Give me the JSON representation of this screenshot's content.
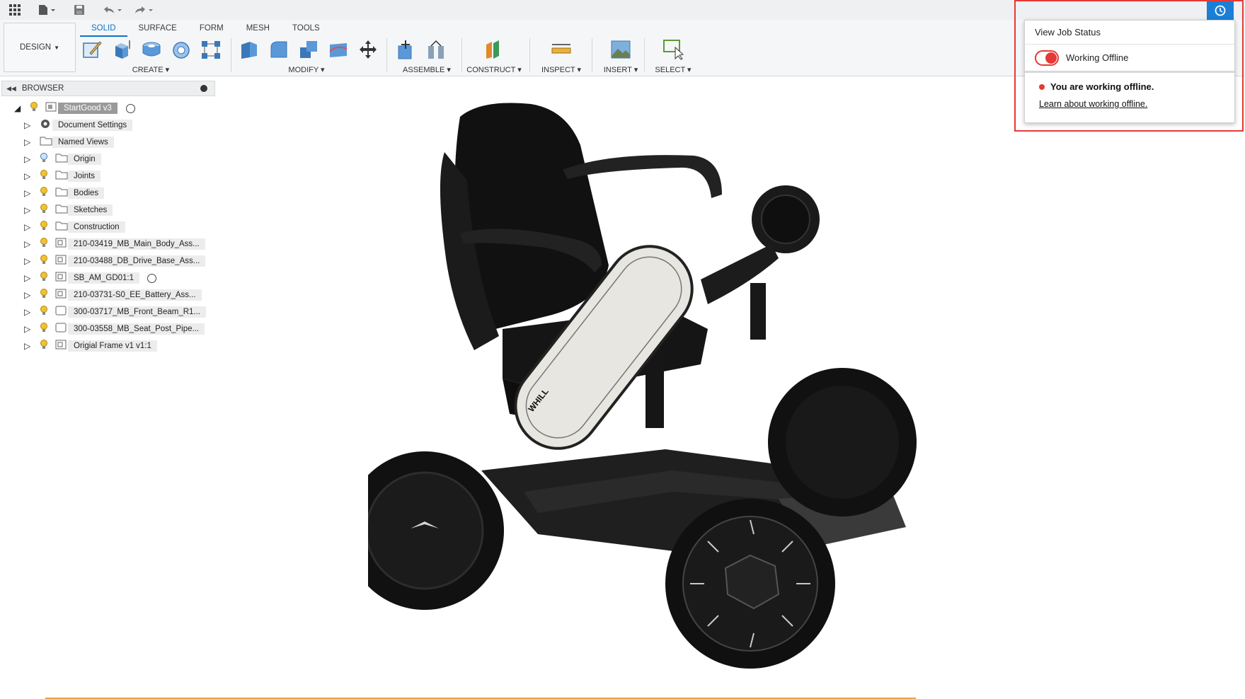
{
  "ribbon": {
    "design_label": "DESIGN",
    "tabs": [
      {
        "label": "SOLID",
        "active": true
      },
      {
        "label": "SURFACE",
        "active": false
      },
      {
        "label": "FORM",
        "active": false
      },
      {
        "label": "MESH",
        "active": false
      },
      {
        "label": "TOOLS",
        "active": false
      }
    ],
    "groups": {
      "create": "CREATE",
      "modify": "MODIFY",
      "assemble": "ASSEMBLE",
      "construct": "CONSTRUCT",
      "inspect": "INSPECT",
      "insert": "INSERT",
      "select": "SELECT"
    }
  },
  "browser": {
    "title": "BROWSER",
    "root": "StartGood v3",
    "items": [
      {
        "label": "Document Settings",
        "icon": "gear-icon"
      },
      {
        "label": "Named Views",
        "icon": "folder-icon"
      },
      {
        "label": "Origin",
        "icon": "folder-icon"
      },
      {
        "label": "Joints",
        "icon": "folder-icon"
      },
      {
        "label": "Bodies",
        "icon": "folder-icon"
      },
      {
        "label": "Sketches",
        "icon": "folder-icon"
      },
      {
        "label": "Construction",
        "icon": "folder-icon"
      },
      {
        "label": "210-03419_MB_Main_Body_Ass...",
        "icon": "component-icon"
      },
      {
        "label": "210-03488_DB_Drive_Base_Ass...",
        "icon": "component-icon"
      },
      {
        "label": "SB_AM_GD01:1",
        "icon": "component-icon"
      },
      {
        "label": "210-03731-S0_EE_Battery_Ass...",
        "icon": "component-icon"
      },
      {
        "label": "300-03717_MB_Front_Beam_R1...",
        "icon": "body-icon"
      },
      {
        "label": "300-03558_MB_Seat_Post_Pipe...",
        "icon": "body-icon"
      },
      {
        "label": "Origial Frame v1 v1:1",
        "icon": "component-icon"
      }
    ]
  },
  "viewport": {
    "brand_mark": "WHILL"
  },
  "job_status": {
    "title": "View Job Status",
    "toggle_label": "Working Offline",
    "warning": "You are working offline.",
    "link": "Learn about working offline."
  },
  "colors": {
    "accent": "#0b74c8",
    "alert": "#e53935"
  }
}
